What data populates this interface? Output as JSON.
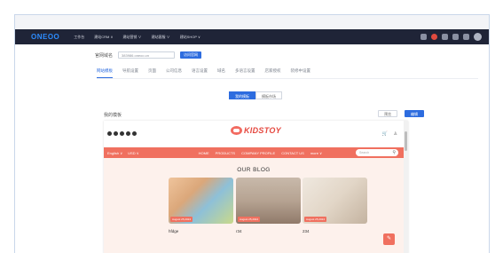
{
  "topbar": {
    "logo": "ONEOO",
    "nav": [
      "工作台",
      "建站CRM ∨",
      "建站营销 ∨",
      "建站客服 ∨",
      "建站SHOP ∨"
    ]
  },
  "domain": {
    "label": "官网域名",
    "value": "383986.oneoo.cn",
    "button": "访问官网"
  },
  "tabs": [
    "网站模板",
    "导航设置",
    "页面",
    "公司信息",
    "语言设置",
    "域名",
    "多语言设置",
    "店家授权",
    "装修中设置"
  ],
  "toggle": {
    "left": "我的模板",
    "right": "模板市场"
  },
  "my_templates": "我的模板",
  "right_buttons": {
    "preview": "预览",
    "edit": "编辑"
  },
  "preview": {
    "brand": "KIDSTOY",
    "nav_left": [
      "English ∨",
      "USD ∨"
    ],
    "nav_menu": [
      "HOME",
      "PRODUCTS",
      "COMPANY PROFILE",
      "CONTACT US",
      "more ∨"
    ],
    "search_placeholder": "Search",
    "blog_title": "OUR BLOG",
    "posts": [
      {
        "date": "August 25,2024",
        "title": "hfdge"
      },
      {
        "date": "August 25,2024",
        "title": "r34"
      },
      {
        "date": "August 25,2024",
        "title": "234"
      }
    ]
  },
  "colors": {
    "accent": "#2d6cdf",
    "brand": "#e5483f",
    "nav": "#f0705f",
    "topbar": "#1f2437"
  }
}
